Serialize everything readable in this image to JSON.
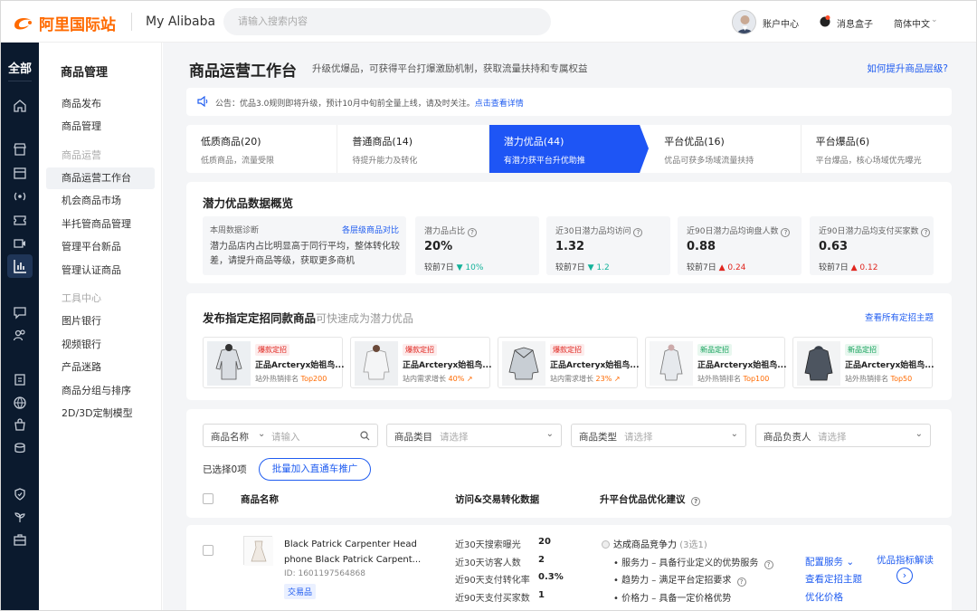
{
  "header": {
    "logo_text": "阿里国际站",
    "brand": "My Alibaba",
    "search_placeholder": "请输入搜索内容",
    "account": "账户中心",
    "messages": "消息盒子",
    "language": "简体中文"
  },
  "rail": {
    "all_label": "全部",
    "icons": [
      "home-icon",
      "shop-icon",
      "box-icon",
      "broadcast-icon",
      "ticket-icon",
      "video-icon",
      "chart-icon",
      "chat-icon",
      "users-icon",
      "clipboard-icon",
      "globe-icon",
      "bag-icon",
      "coins-icon",
      "shield-icon",
      "plant-icon",
      "toolbox-icon"
    ]
  },
  "sidebar": {
    "title": "商品管理",
    "items": [
      {
        "label": "商品发布",
        "type": "item"
      },
      {
        "label": "商品管理",
        "type": "item"
      },
      {
        "label": "商品运营",
        "type": "group"
      },
      {
        "label": "商品运营工作台",
        "type": "item",
        "selected": true
      },
      {
        "label": "机会商品市场",
        "type": "item"
      },
      {
        "label": "半托管商品管理",
        "type": "item"
      },
      {
        "label": "管理平台新品",
        "type": "item"
      },
      {
        "label": "管理认证商品",
        "type": "item"
      },
      {
        "label": "工具中心",
        "type": "group"
      },
      {
        "label": "图片银行",
        "type": "item"
      },
      {
        "label": "视频银行",
        "type": "item"
      },
      {
        "label": "产品迷路",
        "type": "item"
      },
      {
        "label": "商品分组与排序",
        "type": "item"
      },
      {
        "label": "2D/3D定制模型",
        "type": "item"
      }
    ]
  },
  "page": {
    "title": "商品运营工作台",
    "subtitle": "升级优爆品，可获得平台打爆激励机制，获取流量扶持和专属权益",
    "help_link": "如何提升商品层级?"
  },
  "notice": {
    "text": "公告：优品3.0规则即将升级，预计10月中旬前全量上线，请及时关注。",
    "link": "点击查看详情"
  },
  "tabs": [
    {
      "label": "低质商品(20)",
      "desc": "低质商品，流量受限",
      "active": false
    },
    {
      "label": "普通商品(14)",
      "desc": "待提升能力及转化",
      "active": false
    },
    {
      "label": "潜力优品(44)",
      "desc": "有潜力获平台升优助推",
      "active": true
    },
    {
      "label": "平台优品(16)",
      "desc": "优品可获多场域流量扶持",
      "active": false
    },
    {
      "label": "平台爆品(6)",
      "desc": "平台爆品，核心场域优先曝光",
      "active": false
    }
  ],
  "overview": {
    "title": "潜力优品数据概览",
    "diagnosis": {
      "header": "本周数据诊断",
      "link": "各层级商品对比",
      "text": "潜力品店内占比明显高于同行平均，整体转化较差，请提升商品等级，获取更多商机"
    },
    "metrics": [
      {
        "label": "潜力品占比",
        "value": "20%",
        "compare": "较前7日",
        "delta": "10%",
        "dir": "down"
      },
      {
        "label": "近30日潜力品均访问",
        "value": "1.32",
        "compare": "较前7日",
        "delta": "1.2",
        "dir": "down"
      },
      {
        "label": "近90日潜力品均询盘人数",
        "value": "0.88",
        "compare": "较前7日",
        "delta": "0.24",
        "dir": "up"
      },
      {
        "label": "近90日潜力品均支付买家数",
        "value": "0.63",
        "compare": "较前7日",
        "delta": "0.12",
        "dir": "up"
      }
    ]
  },
  "publish": {
    "title": "发布指定定招同款商品",
    "title_suffix": "可快速成为潜力优品",
    "link": "查看所有定招主题",
    "cards": [
      {
        "tag": "爆款定招",
        "tag_type": "hot",
        "name": "正品Arcteryx始祖鸟...",
        "meta_prefix": "站外热销排名",
        "meta_value": "Top200"
      },
      {
        "tag": "爆款定招",
        "tag_type": "hot",
        "name": "正品Arcteryx始祖鸟...",
        "meta_prefix": "站内需求增长",
        "meta_value": "40% ↗"
      },
      {
        "tag": "爆款定招",
        "tag_type": "hot",
        "name": "正品Arcteryx始祖鸟...",
        "meta_prefix": "站内需求增长",
        "meta_value": "23% ↗"
      },
      {
        "tag": "新品定招",
        "tag_type": "new",
        "name": "正品Arcteryx始祖鸟...",
        "meta_prefix": "站外热销排名",
        "meta_value": "Top100"
      },
      {
        "tag": "新品定招",
        "tag_type": "new",
        "name": "正品Arcteryx始祖鸟...",
        "meta_prefix": "站外热销排名",
        "meta_value": "Top50"
      }
    ]
  },
  "filters": [
    {
      "label": "商品名称",
      "placeholder": "请输入",
      "kind": "search"
    },
    {
      "label": "商品类目",
      "placeholder": "请选择",
      "kind": "select"
    },
    {
      "label": "商品类型",
      "placeholder": "请选择",
      "kind": "select"
    },
    {
      "label": "商品负责人",
      "placeholder": "请选择",
      "kind": "select"
    }
  ],
  "list": {
    "selected_count": "已选择0项",
    "batch_button": "批量加入直通车推广",
    "headers": [
      "商品名称",
      "访问&交易转化数据",
      "升平台优品优化建议"
    ]
  },
  "row": {
    "title": "Black Patrick Carpenter Head phone Black Patrick Carpent...",
    "id": "ID: 1601197564868",
    "badge": "交易品",
    "stats": [
      {
        "label": "近30天搜索曝光",
        "value": "20"
      },
      {
        "label": "近30天访客人数",
        "value": "2"
      },
      {
        "label": "近90天支付转化率",
        "value": "0.3%"
      },
      {
        "label": "近90天支付买家数",
        "value": "1"
      }
    ],
    "suggest_title": "达成商品竞争力",
    "suggest_count": "(3选1)",
    "suggestions": [
      "服务力 – 具备行业定义的优势服务",
      "趋势力 – 满足平台定招要求",
      "价格力 – 具备一定价格优势"
    ],
    "actions": [
      "配置服务",
      "查看定招主题",
      "优化价格"
    ],
    "interpret": "优品指标解读"
  }
}
